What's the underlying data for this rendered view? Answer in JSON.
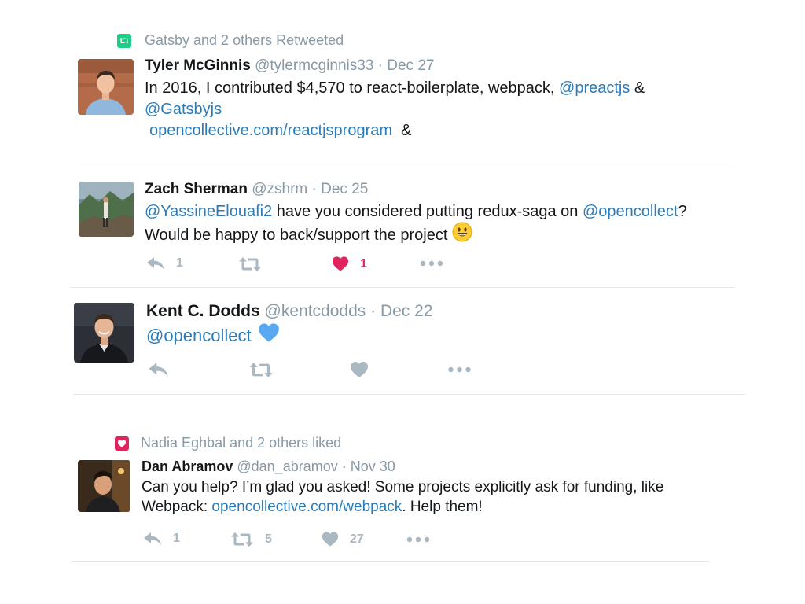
{
  "colors": {
    "retweet": "#19cf86",
    "like": "#e0245e",
    "link": "#2b7bb9",
    "muted": "#8899a6",
    "action": "#aab8c2",
    "text": "#14171a"
  },
  "tweets": [
    {
      "context": "Gatsby and 2 others Retweeted",
      "context_icon": "retweet-icon",
      "name": "Tyler McGinnis",
      "handle": "@tylermcginnis33",
      "dot": "·",
      "date": "Dec 27",
      "line1_text": "In 2016, I contributed $4,570 to react-boilerplate, webpack, ",
      "line1_link": "@preactjs",
      "line1_end": " &",
      "line2_link": "@Gatsbyjs",
      "line3_link": "opencollective.com/reactjsprogram",
      "line3_end": "&"
    },
    {
      "name": "Zach Sherman",
      "handle": "@zshrm",
      "dot": "·",
      "date": "Dec 25",
      "line1_link": "@YassineElouafi2",
      "line1_text": " have you considered putting redux-saga on ",
      "line1_link2": "@opencollect",
      "line1_end": "?",
      "line2_text": "Would be happy to back/support the project",
      "emoji": "smiley-emoji",
      "replies": "1",
      "likes": "1"
    },
    {
      "name": "Kent C. Dodds",
      "handle": "@kentcdodds",
      "dot": "·",
      "date": "Dec 22",
      "line1_link": "@opencollect",
      "emoji": "blue-heart-emoji"
    },
    {
      "context": "Nadia Eghbal and 2 others liked",
      "context_icon": "heart-icon",
      "name": "Dan Abramov",
      "handle": "@dan_abramov",
      "dot": "·",
      "date": "Nov 30",
      "line1_text": "Can you help? I’m glad you asked! Some projects explicitly ask for funding, like",
      "line2_text": "Webpack: ",
      "line2_link": "opencollective.com/webpack",
      "line2_end": ". Help them!",
      "replies": "1",
      "retweets": "5",
      "likes": "27"
    }
  ]
}
